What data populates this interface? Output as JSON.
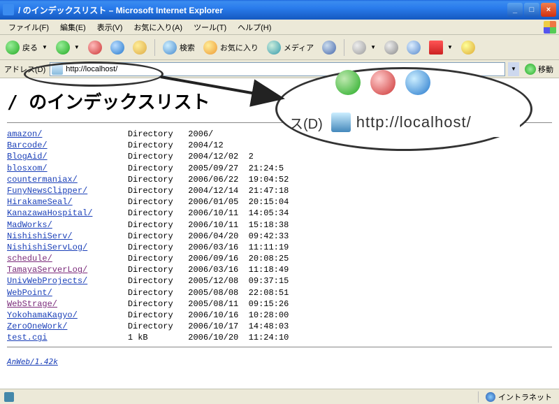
{
  "window": {
    "title": "/ のインデックスリスト – Microsoft Internet Explorer"
  },
  "menu": {
    "items": [
      {
        "label": "ファイル(F)"
      },
      {
        "label": "編集(E)"
      },
      {
        "label": "表示(V)"
      },
      {
        "label": "お気に入り(A)"
      },
      {
        "label": "ツール(T)"
      },
      {
        "label": "ヘルプ(H)"
      }
    ]
  },
  "toolbar": {
    "back": "戻る",
    "search": "検索",
    "favorites": "お気に入り",
    "media": "メディア"
  },
  "address": {
    "label": "アドレス(D)",
    "url": "http://localhost/",
    "go": "移動"
  },
  "page": {
    "heading": "/ のインデックスリスト",
    "entries": [
      {
        "name": "amazon/",
        "type": "Directory",
        "date": "2006/",
        "visited": false
      },
      {
        "name": "Barcode/",
        "type": "Directory",
        "date": "2004/12",
        "visited": false
      },
      {
        "name": "BlogAid/",
        "type": "Directory",
        "date": "2004/12/02  2",
        "visited": false
      },
      {
        "name": "blosxom/",
        "type": "Directory",
        "date": "2005/09/27  21:24:5",
        "visited": false
      },
      {
        "name": "countermaniax/",
        "type": "Directory",
        "date": "2006/06/22  19:04:52",
        "visited": false
      },
      {
        "name": "FunyNewsClipper/",
        "type": "Directory",
        "date": "2004/12/14  21:47:18",
        "visited": false
      },
      {
        "name": "HirakameSeal/",
        "type": "Directory",
        "date": "2006/01/05  20:15:04",
        "visited": false
      },
      {
        "name": "KanazawaHospital/",
        "type": "Directory",
        "date": "2006/10/11  14:05:34",
        "visited": false
      },
      {
        "name": "MadWorks/",
        "type": "Directory",
        "date": "2006/10/11  15:18:38",
        "visited": false
      },
      {
        "name": "NishishiServ/",
        "type": "Directory",
        "date": "2006/04/20  09:42:33",
        "visited": false
      },
      {
        "name": "NishishiServLog/",
        "type": "Directory",
        "date": "2006/03/16  11:11:19",
        "visited": false
      },
      {
        "name": "schedule/",
        "type": "Directory",
        "date": "2006/09/16  20:08:25",
        "visited": true
      },
      {
        "name": "TamayaServerLog/",
        "type": "Directory",
        "date": "2006/03/16  11:18:49",
        "visited": true
      },
      {
        "name": "UnivWebProjects/",
        "type": "Directory",
        "date": "2005/12/08  09:37:15",
        "visited": false
      },
      {
        "name": "WebPoint/",
        "type": "Directory",
        "date": "2005/08/08  22:08:51",
        "visited": false
      },
      {
        "name": "WebStrage/",
        "type": "Directory",
        "date": "2005/08/11  09:15:26",
        "visited": true
      },
      {
        "name": "YokohamaKagyo/",
        "type": "Directory",
        "date": "2006/10/16  10:28:00",
        "visited": false
      },
      {
        "name": "ZeroOneWork/",
        "type": "Directory",
        "date": "2006/10/17  14:48:03",
        "visited": false
      },
      {
        "name": "test.cgi",
        "type": "1 kB",
        "date": "2006/10/20  11:24:10",
        "visited": false
      }
    ],
    "server": "AnWeb/1.42k"
  },
  "callout": {
    "label": "ス(D)",
    "url": "http://localhost/"
  },
  "status": {
    "zone": "イントラネット"
  }
}
